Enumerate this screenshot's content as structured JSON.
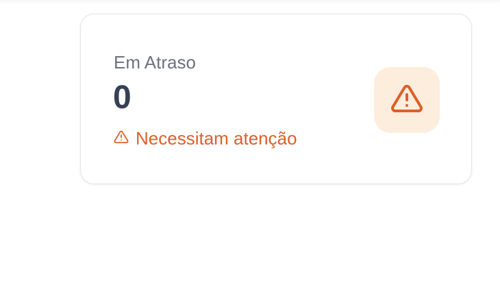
{
  "card": {
    "label": "Em Atraso",
    "value": "0",
    "note": "Necessitam atenção",
    "icon": "warning-triangle-icon",
    "accent_color": "#dd5f2a",
    "icon_background": "#fdeddc"
  }
}
